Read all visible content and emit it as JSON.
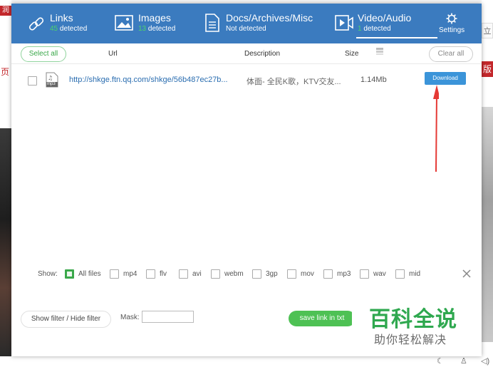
{
  "background": {
    "left_tag": "润",
    "left_text": "页",
    "right_tag": "立",
    "right_text": "版"
  },
  "header": {
    "tabs": [
      {
        "id": "links",
        "title": "Links",
        "count": "45",
        "suffix": "detected",
        "icon": "link-icon"
      },
      {
        "id": "images",
        "title": "Images",
        "count": "13",
        "suffix": "detected",
        "icon": "image-icon"
      },
      {
        "id": "docs",
        "title": "Docs/Archives/Misc",
        "count": "",
        "suffix": "Not detected",
        "icon": "document-icon"
      },
      {
        "id": "video",
        "title": "Video/Audio",
        "count": "1",
        "suffix": "detected",
        "icon": "video-icon",
        "active": true
      }
    ],
    "settings_label": "Settings",
    "settings_icon": "gear-icon",
    "accent_color": "#3b7bbf",
    "count_color": "#4ed36b"
  },
  "columns": {
    "select_all": "Select all",
    "url": "Url",
    "description": "Description",
    "size": "Size",
    "size_icon": "stack-icon",
    "clear_all": "Clear all"
  },
  "rows": [
    {
      "file_type": "mp3",
      "url": "http://shkge.ftn.qq.com/shkge/56b487ec27b...",
      "description": "体面- 全民K歌，KTV交友...",
      "size": "1.14Mb",
      "download_label": "Download"
    }
  ],
  "filters": {
    "show_label": "Show:",
    "options": [
      {
        "label": "All files",
        "checked": true
      },
      {
        "label": "mp4",
        "checked": false
      },
      {
        "label": "flv",
        "checked": false
      },
      {
        "label": "avi",
        "checked": false
      },
      {
        "label": "webm",
        "checked": false
      },
      {
        "label": "3gp",
        "checked": false
      },
      {
        "label": "mov",
        "checked": false
      },
      {
        "label": "mp3",
        "checked": false
      },
      {
        "label": "wav",
        "checked": false
      },
      {
        "label": "mid",
        "checked": false
      }
    ]
  },
  "bottom": {
    "filter_toggle": "Show filter / Hide filter",
    "mask_label": "Mask:",
    "mask_value": "",
    "save_button": "save link in txt"
  },
  "watermark": {
    "line1": "百科全说",
    "line2": "助你轻松解决"
  }
}
